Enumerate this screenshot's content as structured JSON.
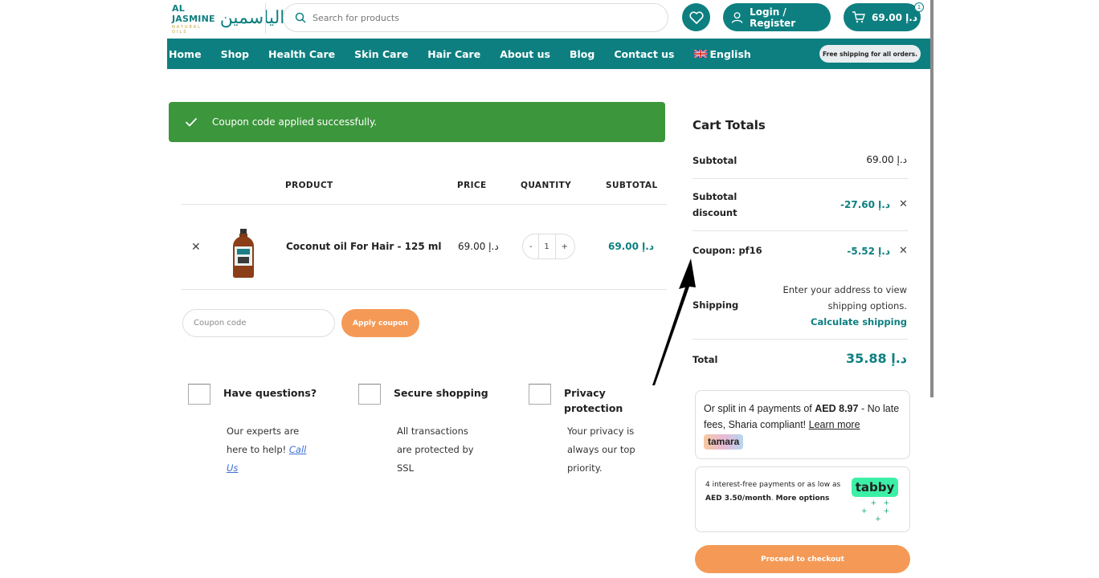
{
  "header": {
    "logo_text": "AL JASMINE",
    "logo_sub": "NATURAL OILS",
    "logo_arabic": "الياسمين",
    "search_placeholder": "Search for products",
    "login_label": "Login / Register",
    "cart_amount": "د.إ 69.00",
    "cart_count": "1"
  },
  "nav": {
    "items": [
      "Home",
      "Shop",
      "Health Care",
      "Skin Care",
      "Hair Care",
      "About us",
      "Blog",
      "Contact us",
      "English"
    ],
    "free_shipping": "Free shipping for all orders."
  },
  "notice": {
    "message": "Coupon code applied successfully."
  },
  "table": {
    "headers": {
      "product": "PRODUCT",
      "price": "PRICE",
      "quantity": "QUANTITY",
      "subtotal": "SUBTOTAL"
    },
    "rows": [
      {
        "name": "Coconut oil For Hair - 125 ml",
        "price": "د.إ 69.00",
        "quantity": "1",
        "subtotal": "د.إ 69.00"
      }
    ]
  },
  "coupon": {
    "placeholder": "Coupon code",
    "apply_label": "Apply coupon"
  },
  "features": [
    {
      "title": "Have questions?",
      "desc": "Our experts are here to help!",
      "link": "Call Us"
    },
    {
      "title": "Secure shopping",
      "desc": "All transactions are protected by SSL"
    },
    {
      "title": "Privacy protection",
      "desc": "Your privacy is always our top priority."
    }
  ],
  "totals": {
    "title": "Cart Totals",
    "subtotal_label": "Subtotal",
    "subtotal_value": "د.إ 69.00",
    "discount_label": "Subtotal discount",
    "discount_value": "-د.إ 27.60",
    "coupon_label": "Coupon: pf16",
    "coupon_value": "-د.إ 5.52",
    "shipping_label": "Shipping",
    "shipping_info": "Enter your address to view shipping options.",
    "calc_shipping": "Calculate shipping",
    "total_label": "Total",
    "total_value": "د.إ 35.88"
  },
  "tamara": {
    "text_pre": "Or split in 4 payments of ",
    "amount": "AED 8.97",
    "text_post": " - No late fees, Sharia compliant! ",
    "learn_more": "Learn more",
    "badge": "tamara"
  },
  "tabby": {
    "text_pre": "4 interest-free payments or as low as ",
    "amount": "AED 3.50/month",
    "more": "More options",
    "logo": "tabby"
  },
  "checkout_label": "Proceed to checkout",
  "colors": {
    "brand": "#0e7f80",
    "accent": "#f49a56",
    "success": "#3c963c"
  }
}
